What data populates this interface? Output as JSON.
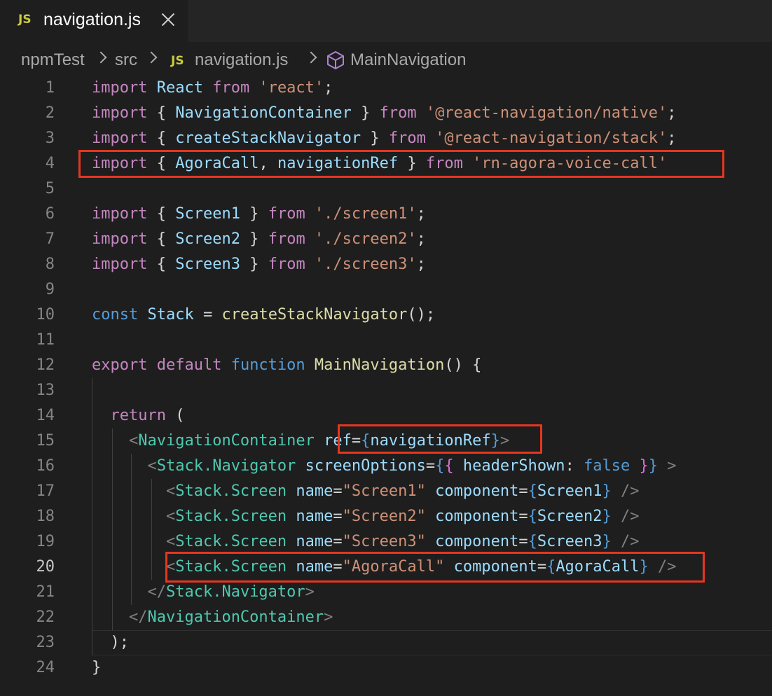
{
  "tab": {
    "badge": "JS",
    "title": "navigation.js"
  },
  "breadcrumb": {
    "items": [
      "npmTest",
      "src",
      "navigation.js",
      "MainNavigation"
    ],
    "badge": "JS"
  },
  "editor": {
    "active_line": 20,
    "lines": [
      {
        "n": "1",
        "t": [
          [
            "kw",
            "import"
          ],
          [
            "",
            ""
          ],
          [
            "vr",
            " React"
          ],
          [
            "kw",
            " from"
          ],
          [
            "st",
            " 'react'"
          ],
          [
            "",
            ";"
          ]
        ]
      },
      {
        "n": "2",
        "t": [
          [
            "kw",
            "import"
          ],
          [
            "",
            " { "
          ],
          [
            "vr",
            "NavigationContainer"
          ],
          [
            "",
            " } "
          ],
          [
            "kw",
            "from"
          ],
          [
            "st",
            " '@react-navigation/native'"
          ],
          [
            "",
            ";"
          ]
        ]
      },
      {
        "n": "3",
        "t": [
          [
            "kw",
            "import"
          ],
          [
            "",
            " { "
          ],
          [
            "vr",
            "createStackNavigator"
          ],
          [
            "",
            " } "
          ],
          [
            "kw",
            "from"
          ],
          [
            "st",
            " '@react-navigation/stack'"
          ],
          [
            "",
            ";"
          ]
        ]
      },
      {
        "n": "4",
        "t": [
          [
            "kw",
            "import"
          ],
          [
            "",
            " { "
          ],
          [
            "vr",
            "AgoraCall"
          ],
          [
            "",
            ", "
          ],
          [
            "vr",
            "navigationRef"
          ],
          [
            "",
            " } "
          ],
          [
            "kw",
            "from"
          ],
          [
            "st",
            " 'rn-agora-voice-call'"
          ]
        ]
      },
      {
        "n": "5",
        "t": []
      },
      {
        "n": "6",
        "t": [
          [
            "kw",
            "import"
          ],
          [
            "",
            " { "
          ],
          [
            "vr",
            "Screen1"
          ],
          [
            "",
            " } "
          ],
          [
            "kw",
            "from"
          ],
          [
            "st",
            " './screen1'"
          ],
          [
            "",
            ";"
          ]
        ]
      },
      {
        "n": "7",
        "t": [
          [
            "kw",
            "import"
          ],
          [
            "",
            " { "
          ],
          [
            "vr",
            "Screen2"
          ],
          [
            "",
            " } "
          ],
          [
            "kw",
            "from"
          ],
          [
            "st",
            " './screen2'"
          ],
          [
            "",
            ";"
          ]
        ]
      },
      {
        "n": "8",
        "t": [
          [
            "kw",
            "import"
          ],
          [
            "",
            " { "
          ],
          [
            "vr",
            "Screen3"
          ],
          [
            "",
            " } "
          ],
          [
            "kw",
            "from"
          ],
          [
            "st",
            " './screen3'"
          ],
          [
            "",
            ";"
          ]
        ]
      },
      {
        "n": "9",
        "t": []
      },
      {
        "n": "10",
        "t": [
          [
            "bl",
            "const"
          ],
          [
            "vr",
            " Stack"
          ],
          [
            "",
            " = "
          ],
          [
            "fn",
            "createStackNavigator"
          ],
          [
            "",
            "();"
          ]
        ]
      },
      {
        "n": "11",
        "t": []
      },
      {
        "n": "12",
        "t": [
          [
            "kw",
            "export"
          ],
          [
            "kw",
            " default"
          ],
          [
            "bl",
            " function"
          ],
          [
            "fn",
            " MainNavigation"
          ],
          [
            "",
            "() {"
          ]
        ]
      },
      {
        "n": "13",
        "t": []
      },
      {
        "n": "14",
        "t": [
          [
            "",
            "  "
          ],
          [
            "kw",
            "return"
          ],
          [
            "",
            " ("
          ]
        ]
      },
      {
        "n": "15",
        "t": [
          [
            "",
            "    "
          ],
          [
            "pn",
            "<"
          ],
          [
            "tg",
            "NavigationContainer"
          ],
          [
            "vr",
            " ref"
          ],
          [
            "",
            "="
          ],
          [
            "bl",
            "{"
          ],
          [
            "vr",
            "navigationRef"
          ],
          [
            "bl",
            "}"
          ],
          [
            "pn",
            ">"
          ]
        ]
      },
      {
        "n": "16",
        "t": [
          [
            "",
            "      "
          ],
          [
            "pn",
            "<"
          ],
          [
            "tg",
            "Stack.Navigator"
          ],
          [
            "vr",
            " screenOptions"
          ],
          [
            "",
            "="
          ],
          [
            "bl",
            "{"
          ],
          [
            "br2",
            "{"
          ],
          [
            "vr",
            " headerShown"
          ],
          [
            "",
            ": "
          ],
          [
            "bl",
            "false"
          ],
          [
            "br2",
            " }"
          ],
          [
            "bl",
            "}"
          ],
          [
            "pn",
            " >"
          ]
        ]
      },
      {
        "n": "17",
        "t": [
          [
            "",
            "        "
          ],
          [
            "pn",
            "<"
          ],
          [
            "tg",
            "Stack.Screen"
          ],
          [
            "vr",
            " name"
          ],
          [
            "",
            "="
          ],
          [
            "st",
            "\"Screen1\""
          ],
          [
            "vr",
            " component"
          ],
          [
            "",
            "="
          ],
          [
            "bl",
            "{"
          ],
          [
            "vr",
            "Screen1"
          ],
          [
            "bl",
            "}"
          ],
          [
            "pn",
            " />"
          ]
        ]
      },
      {
        "n": "18",
        "t": [
          [
            "",
            "        "
          ],
          [
            "pn",
            "<"
          ],
          [
            "tg",
            "Stack.Screen"
          ],
          [
            "vr",
            " name"
          ],
          [
            "",
            "="
          ],
          [
            "st",
            "\"Screen2\""
          ],
          [
            "vr",
            " component"
          ],
          [
            "",
            "="
          ],
          [
            "bl",
            "{"
          ],
          [
            "vr",
            "Screen2"
          ],
          [
            "bl",
            "}"
          ],
          [
            "pn",
            " />"
          ]
        ]
      },
      {
        "n": "19",
        "t": [
          [
            "",
            "        "
          ],
          [
            "pn",
            "<"
          ],
          [
            "tg",
            "Stack.Screen"
          ],
          [
            "vr",
            " name"
          ],
          [
            "",
            "="
          ],
          [
            "st",
            "\"Screen3\""
          ],
          [
            "vr",
            " component"
          ],
          [
            "",
            "="
          ],
          [
            "bl",
            "{"
          ],
          [
            "vr",
            "Screen3"
          ],
          [
            "bl",
            "}"
          ],
          [
            "pn",
            " />"
          ]
        ]
      },
      {
        "n": "20",
        "t": [
          [
            "",
            "        "
          ],
          [
            "pn",
            "<"
          ],
          [
            "tg",
            "Stack.Screen"
          ],
          [
            "vr",
            " name"
          ],
          [
            "",
            "="
          ],
          [
            "st",
            "\"AgoraCall\""
          ],
          [
            "vr",
            " component"
          ],
          [
            "",
            "="
          ],
          [
            "bl",
            "{"
          ],
          [
            "vr",
            "AgoraCall"
          ],
          [
            "bl",
            "}"
          ],
          [
            "pn",
            " />"
          ]
        ]
      },
      {
        "n": "21",
        "t": [
          [
            "",
            "      "
          ],
          [
            "pn",
            "</"
          ],
          [
            "tg",
            "Stack.Navigator"
          ],
          [
            "pn",
            ">"
          ]
        ]
      },
      {
        "n": "22",
        "t": [
          [
            "",
            "    "
          ],
          [
            "pn",
            "</"
          ],
          [
            "tg",
            "NavigationContainer"
          ],
          [
            "pn",
            ">"
          ]
        ]
      },
      {
        "n": "23",
        "t": [
          [
            "",
            "  );"
          ]
        ]
      },
      {
        "n": "24",
        "t": [
          [
            "",
            "}"
          ]
        ]
      }
    ]
  },
  "colors": {
    "highlight_box": "#e6361f",
    "background": "#1e1e1e"
  }
}
